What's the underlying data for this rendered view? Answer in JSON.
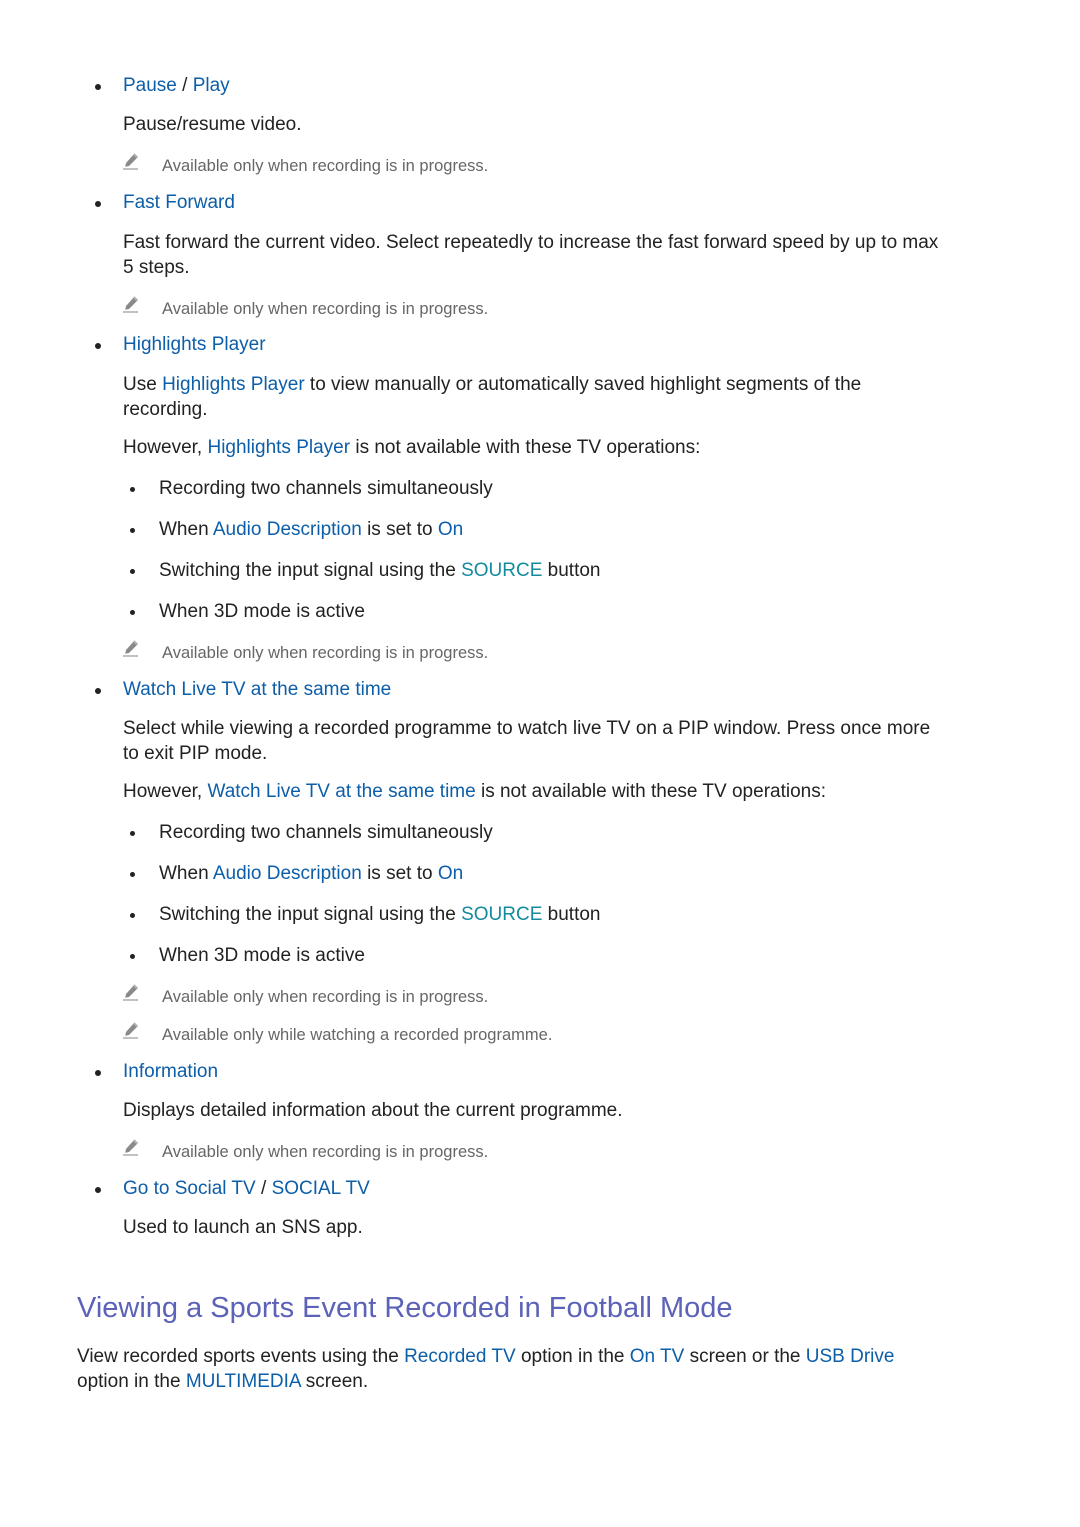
{
  "items": [
    {
      "title_parts": [
        "Pause",
        "Play"
      ],
      "desc": "Pause/resume video.",
      "notes": [
        "Available only when recording is in progress."
      ]
    },
    {
      "title": "Fast Forward",
      "desc_line1": "Fast forward the current video. Select repeatedly to increase the fast forward speed by up to max",
      "desc_line2": "5 steps.",
      "notes": [
        "Available only when recording is in progress."
      ]
    },
    {
      "title": "Highlights Player",
      "desc1": {
        "pre": "Use ",
        "hl": "Highlights Player",
        "post": " to view manually or automatically saved highlight segments of the",
        "line2": "recording."
      },
      "desc2": {
        "pre": "However, ",
        "hl": "Highlights Player",
        "post": " is not available with these TV operations:"
      },
      "subitems": {
        "recording": "Recording two channels simultaneously",
        "audio_pre": "When ",
        "audio_hl": "Audio Description",
        "audio_mid": " is set to ",
        "audio_on": "On",
        "source_pre": "Switching the input signal using the ",
        "source_hl": "SOURCE",
        "source_post": " button",
        "mode3d": "When 3D mode is active"
      },
      "notes": [
        "Available only when recording is in progress."
      ]
    },
    {
      "title": "Watch Live TV at the same time",
      "desc1_line1": "Select while viewing a recorded programme to watch live TV on a PIP window. Press once more",
      "desc1_line2": "to exit PIP mode.",
      "desc2": {
        "pre": "However, ",
        "hl": "Watch Live TV at the same time",
        "post": " is not available with these TV operations:"
      },
      "subitems": {
        "recording": "Recording two channels simultaneously",
        "audio_pre": "When ",
        "audio_hl": "Audio Description",
        "audio_mid": " is set to ",
        "audio_on": "On",
        "source_pre": "Switching the input signal using the ",
        "source_hl": "SOURCE",
        "source_post": " button",
        "mode3d": "When 3D mode is active"
      },
      "notes": [
        "Available only when recording is in progress.",
        "Available only while watching a recorded programme."
      ]
    },
    {
      "title": "Information",
      "desc": "Displays detailed information about the current programme.",
      "notes": [
        "Available only when recording is in progress."
      ]
    },
    {
      "title_parts": [
        "Go to Social TV",
        "SOCIAL TV"
      ],
      "desc": "Used to launch an SNS app."
    }
  ],
  "section": {
    "heading": "Viewing a Sports Event Recorded in Football Mode",
    "p_pre": "View recorded sports events using the ",
    "p_hl1": "Recorded TV",
    "p_mid1": " option in the ",
    "p_hl2": "On TV",
    "p_mid2": " screen or the ",
    "p_hl3": "USB Drive",
    "p_line2_pre": "option in the ",
    "p_hl4": "MULTIMEDIA",
    "p_line2_post": " screen."
  },
  "icons": {
    "note": "pencil-icon",
    "bullet": "bullet-dot"
  }
}
